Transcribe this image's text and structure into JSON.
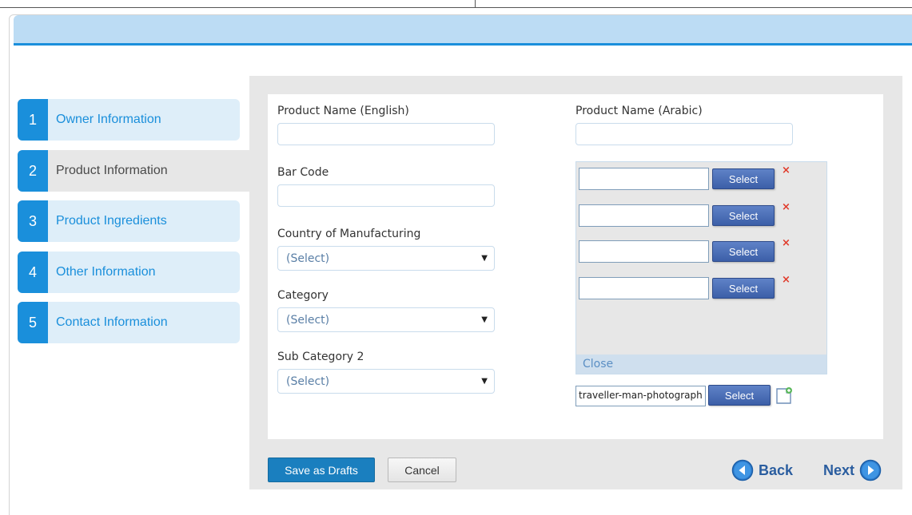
{
  "steps": [
    {
      "num": "1",
      "label": "Owner Information"
    },
    {
      "num": "2",
      "label": "Product Information"
    },
    {
      "num": "3",
      "label": "Product Ingredients"
    },
    {
      "num": "4",
      "label": "Other Information"
    },
    {
      "num": "5",
      "label": "Contact Information"
    }
  ],
  "active_step": "2",
  "form": {
    "product_name_en_label": "Product Name (English)",
    "product_name_en_value": "",
    "product_name_ar_label": "Product Name (Arabic)",
    "product_name_ar_value": "",
    "barcode_label": "Bar Code",
    "barcode_value": "",
    "country_label": "Country of Manufacturing",
    "country_value": "(Select)",
    "category_label": "Category",
    "category_value": "(Select)",
    "subcategory_label": "Sub Category 2",
    "subcategory_value": "(Select)"
  },
  "attachments": {
    "rows": [
      {
        "value": "",
        "button": "Select",
        "remove": "×"
      },
      {
        "value": "",
        "button": "Select",
        "remove": "×"
      },
      {
        "value": "",
        "button": "Select",
        "remove": "×"
      },
      {
        "value": "",
        "button": "Select",
        "remove": "×"
      }
    ],
    "close_label": "Close",
    "file_value": "traveller-man-photograph",
    "file_button": "Select",
    "new_icon": "new-file-icon"
  },
  "actions": {
    "save_label": "Save as Drafts",
    "cancel_label": "Cancel",
    "back_label": "Back",
    "next_label": "Next"
  },
  "colors": {
    "accent": "#1a8fdb",
    "banner": "#bcdcf4",
    "panel": "#e7e7e7",
    "nav_text": "#2a5d9f",
    "remove": "#e03a2a"
  }
}
